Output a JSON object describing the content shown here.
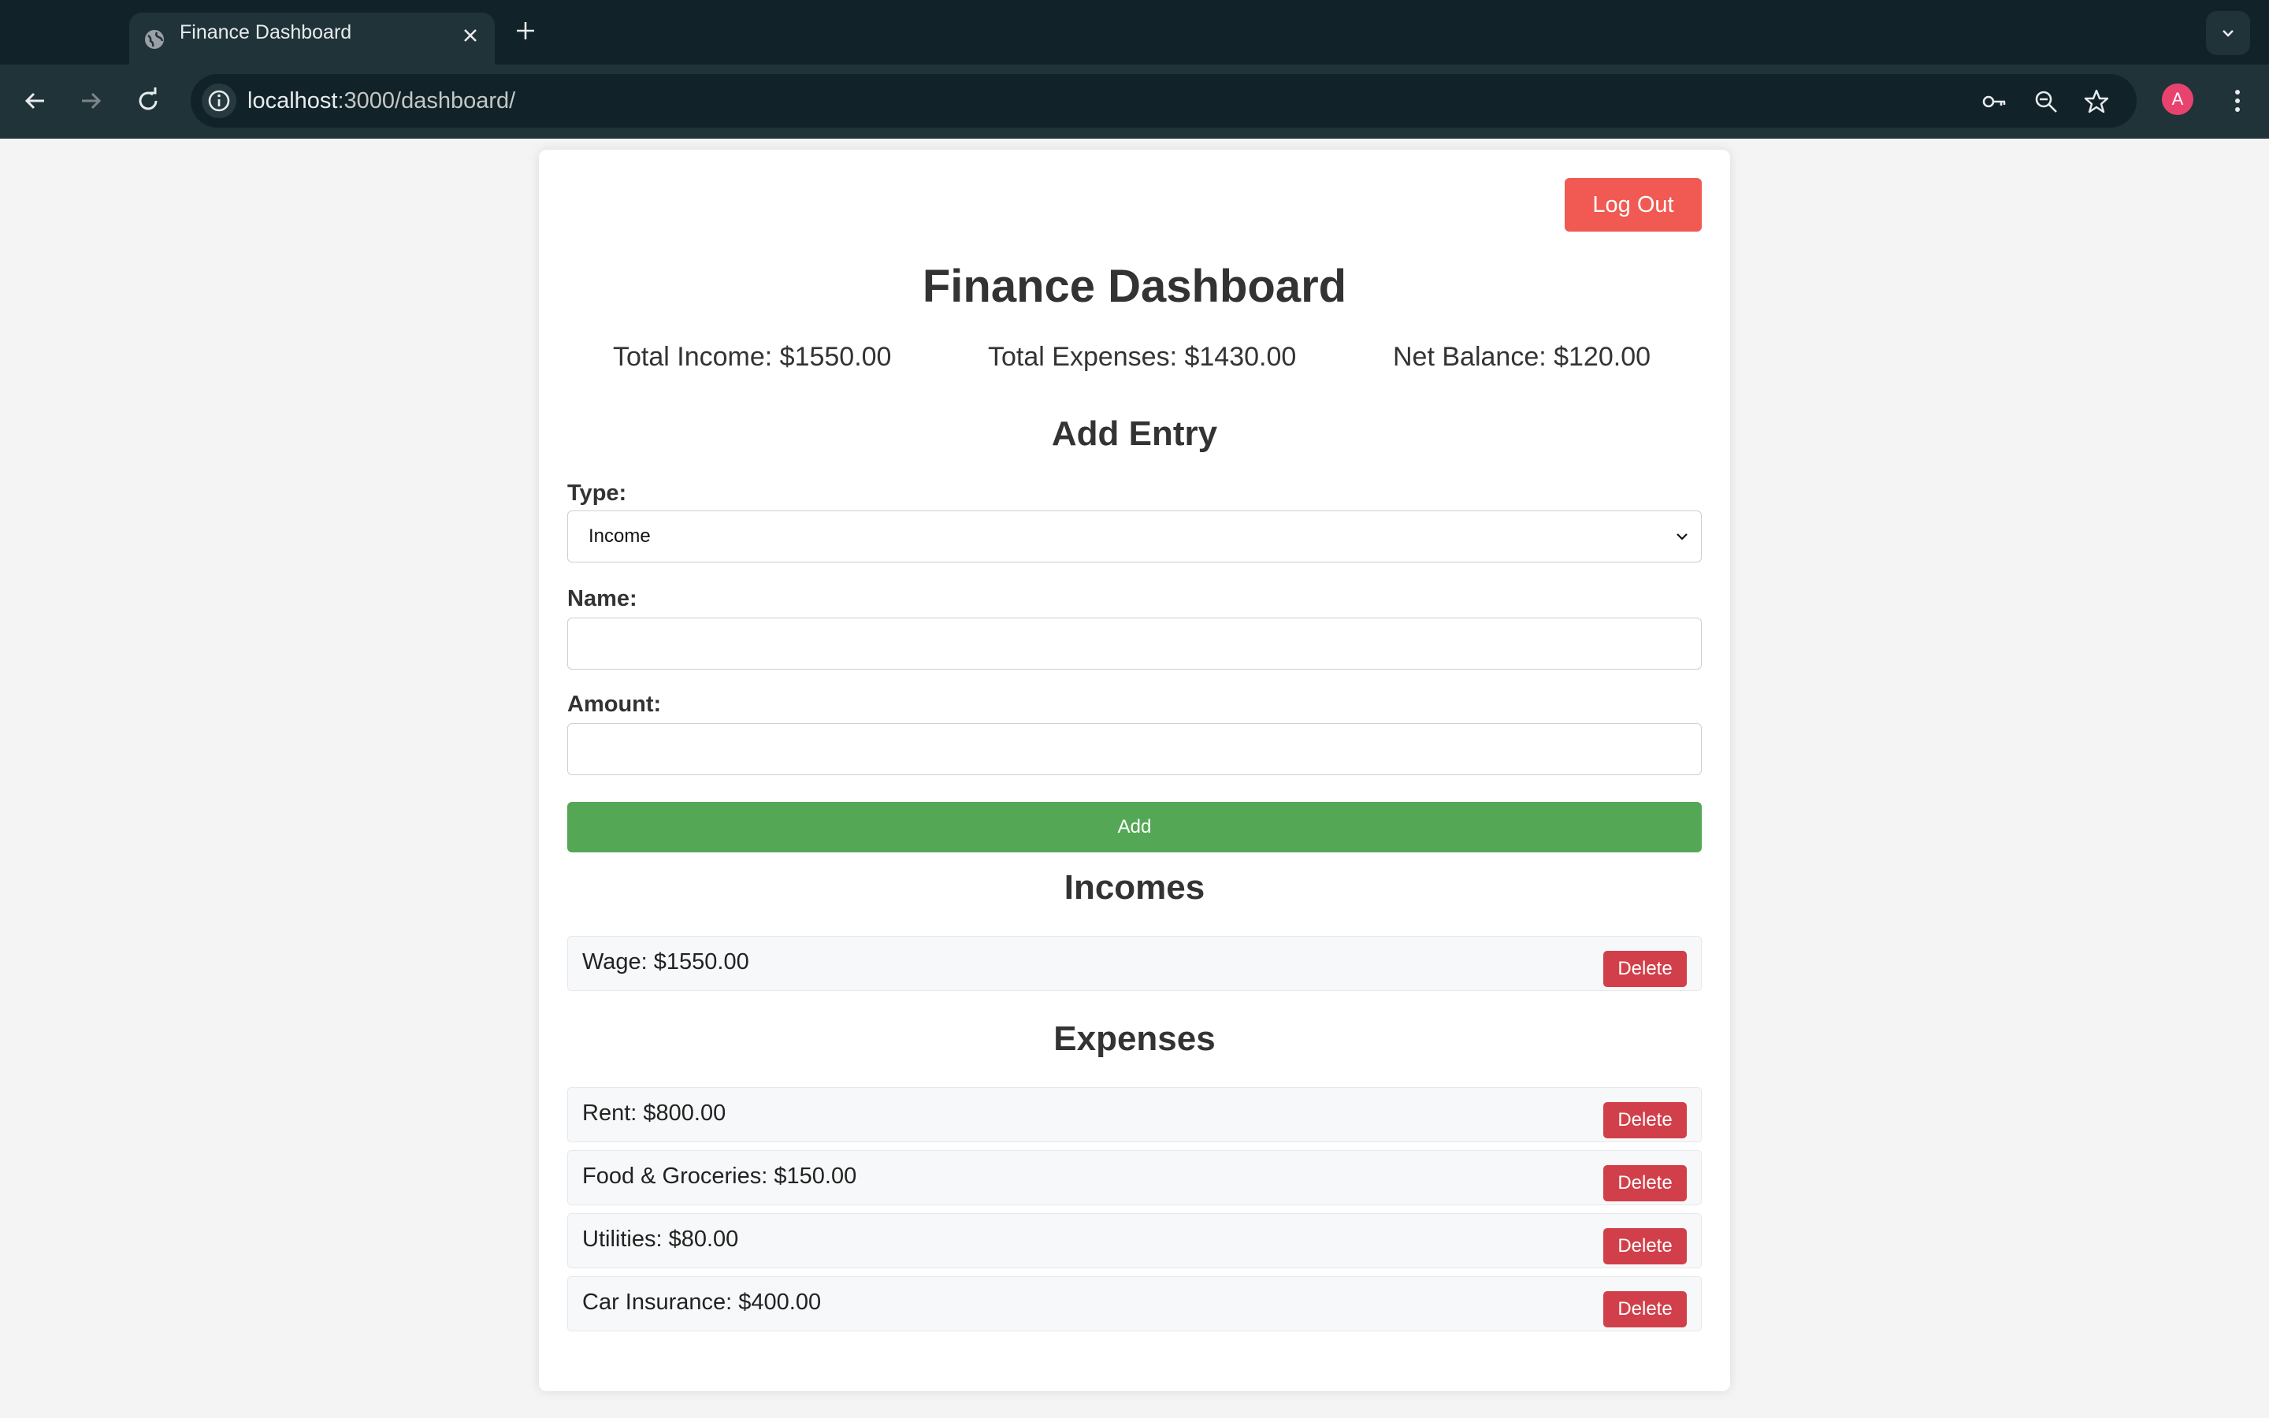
{
  "browser": {
    "tab_title": "Finance Dashboard",
    "url_host": "localhost",
    "url_path": ":3000/dashboard/",
    "avatar_letter": "A"
  },
  "header": {
    "logout_label": "Log Out",
    "title": "Finance Dashboard"
  },
  "summary": {
    "income": "Total Income: $1550.00",
    "expenses": "Total Expenses: $1430.00",
    "balance": "Net Balance: $120.00"
  },
  "form": {
    "heading": "Add Entry",
    "type_label": "Type:",
    "type_value": "Income",
    "name_label": "Name:",
    "name_value": "",
    "amount_label": "Amount:",
    "amount_value": "",
    "add_label": "Add"
  },
  "incomes": {
    "heading": "Incomes",
    "items": [
      {
        "text": "Wage: $1550.00",
        "delete_label": "Delete"
      }
    ]
  },
  "expenses": {
    "heading": "Expenses",
    "items": [
      {
        "text": "Rent: $800.00",
        "delete_label": "Delete"
      },
      {
        "text": "Food & Groceries: $150.00",
        "delete_label": "Delete"
      },
      {
        "text": "Utilities: $80.00",
        "delete_label": "Delete"
      },
      {
        "text": "Car Insurance: $400.00",
        "delete_label": "Delete"
      }
    ]
  },
  "colors": {
    "logout": "#f05a52",
    "add": "#54a754",
    "delete": "#d1404a",
    "chrome_dark": "#112328",
    "chrome_toolbar": "#1f3338"
  }
}
